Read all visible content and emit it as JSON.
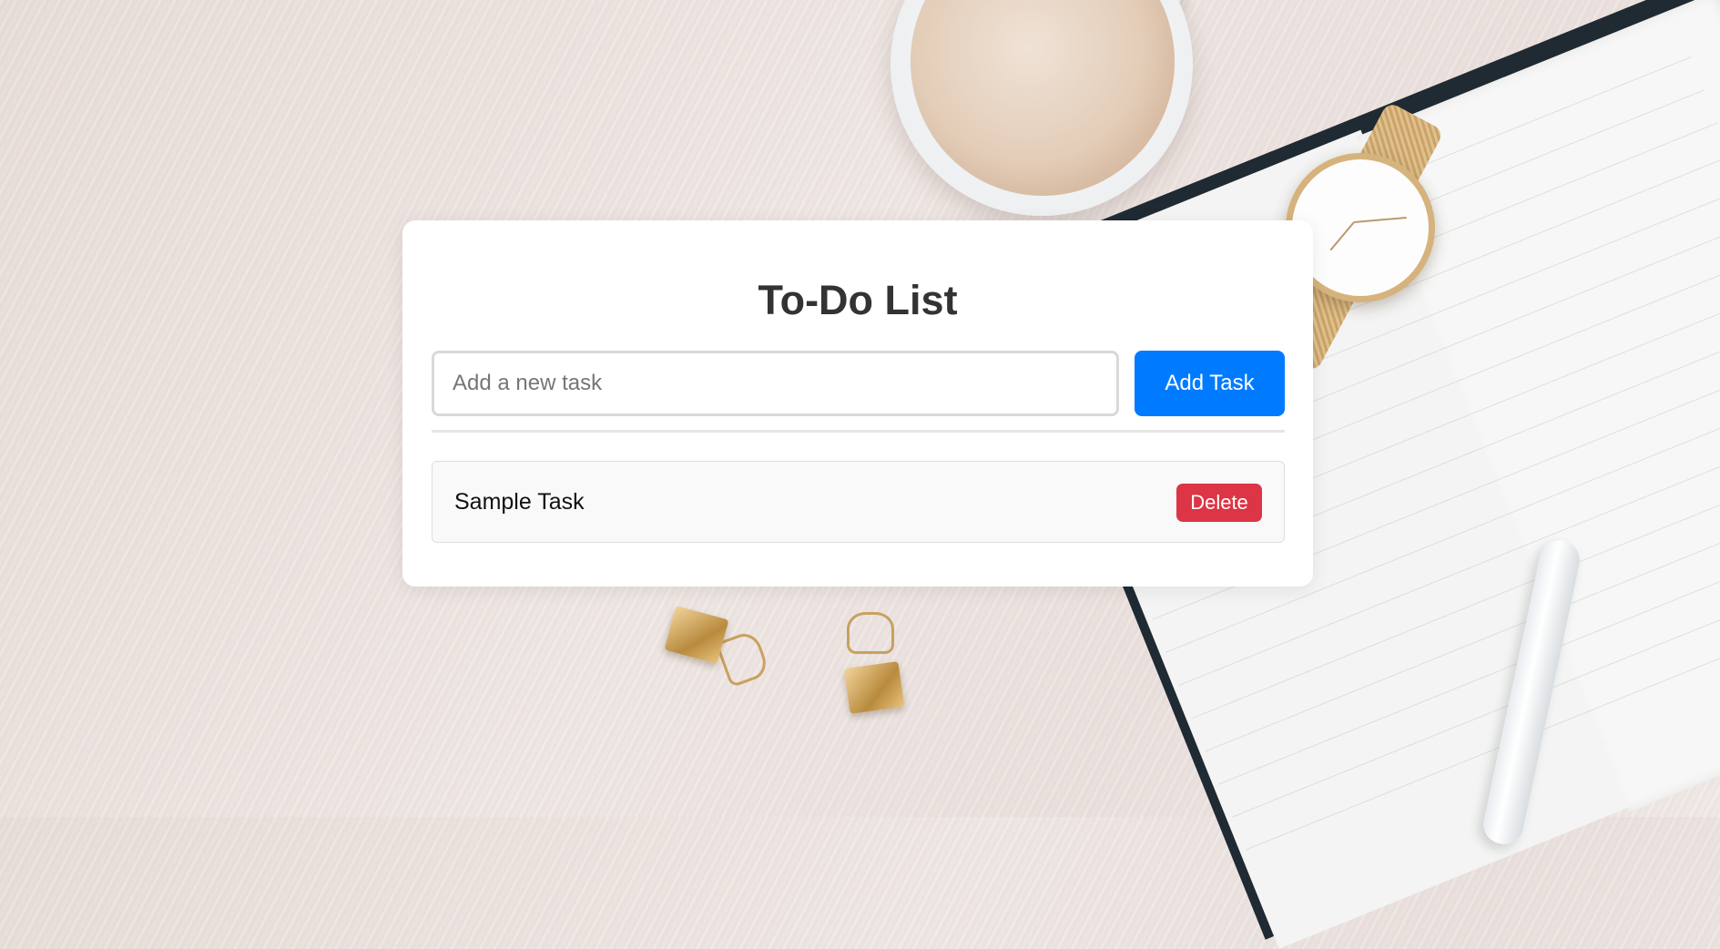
{
  "app": {
    "title": "To-Do List"
  },
  "new_task": {
    "placeholder": "Add a new task",
    "value": "",
    "add_button_label": "Add Task"
  },
  "tasks": [
    {
      "text": "Sample Task",
      "delete_label": "Delete"
    }
  ],
  "colors": {
    "primary": "#007bff",
    "danger": "#dc3545",
    "card_bg": "#ffffff",
    "task_bg": "#f9f9f9"
  },
  "icons": [
    "coffee-cup-photo",
    "wristwatch-photo",
    "notebook-photo",
    "pen-photo",
    "binder-clip-photo"
  ]
}
